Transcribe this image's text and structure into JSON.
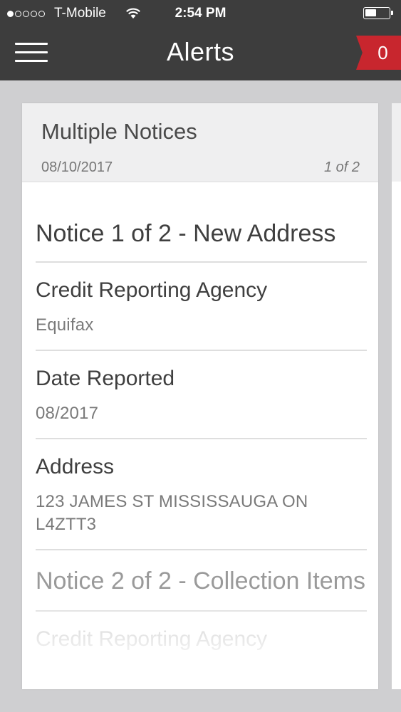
{
  "status_bar": {
    "carrier": "T-Mobile",
    "time": "2:54 PM",
    "signal_bars_filled": 1,
    "signal_bars_total": 5
  },
  "nav": {
    "title": "Alerts",
    "menu_icon": "hamburger-menu-icon",
    "alert_count": "0",
    "badge_color": "#c8262e",
    "bar_color": "#3d3d3d"
  },
  "card": {
    "title": "Multiple Notices",
    "date": "08/10/2017",
    "pager": "1 of 2",
    "notices": [
      {
        "heading": "Notice 1 of 2 - New Address",
        "fields": [
          {
            "label": "Credit Reporting Agency",
            "value": "Equifax"
          },
          {
            "label": "Date Reported",
            "value": "08/2017"
          },
          {
            "label": "Address",
            "value": "123 JAMES ST MISSISSAUGA ON L4ZTT3"
          }
        ]
      },
      {
        "heading": "Notice 2 of 2 - Collection Items",
        "fields": [
          {
            "label": "Credit Reporting Agency"
          }
        ]
      }
    ]
  }
}
